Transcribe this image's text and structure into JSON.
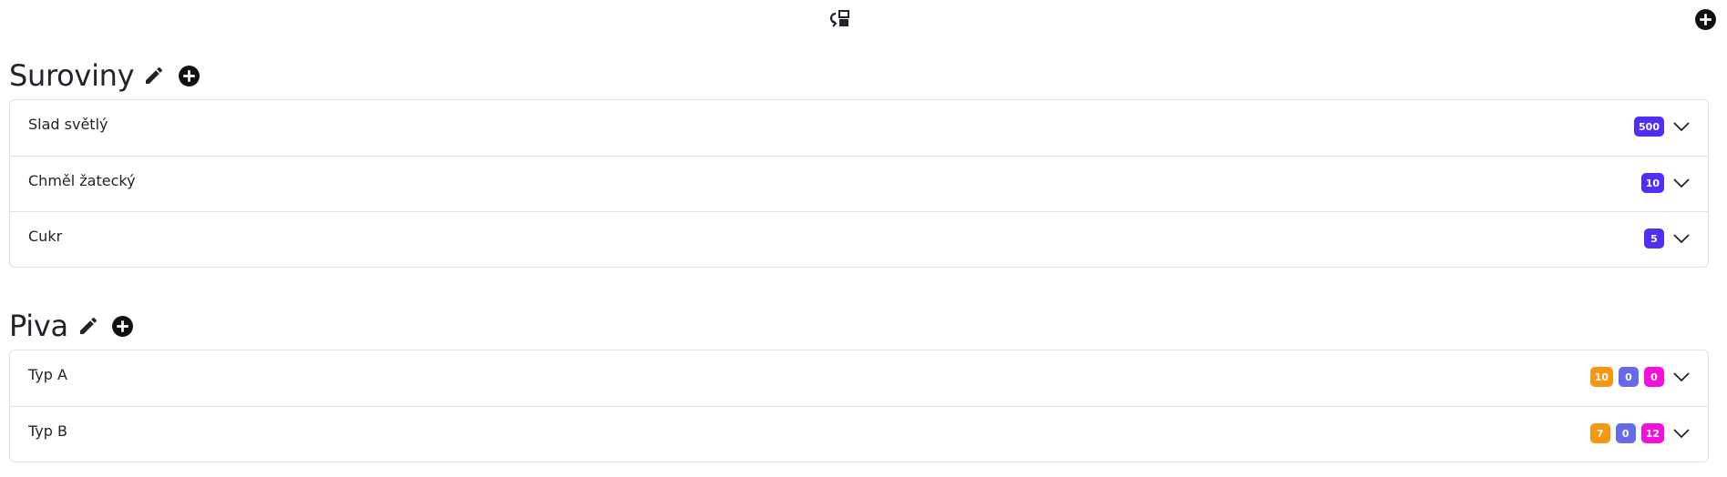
{
  "topbar": {
    "center_icon": "layout-toggle-icon",
    "right_icon": "plus-circle-icon"
  },
  "colors": {
    "primary_badge": "#4d2ff5",
    "orange_badge": "#f7960f",
    "blue_badge": "#6669e9",
    "magenta_badge": "#f50fdc",
    "border": "#dee2e6",
    "text": "#212529"
  },
  "sections": [
    {
      "title": "Suroviny",
      "items": [
        {
          "label": "Slad světlý",
          "badges": [
            "500"
          ]
        },
        {
          "label": "Chměl žatecký",
          "badges": [
            "10"
          ]
        },
        {
          "label": "Cukr",
          "badges": [
            "5"
          ]
        }
      ]
    },
    {
      "title": "Piva",
      "items": [
        {
          "label": "Typ A",
          "badges": [
            "10",
            "0",
            "0"
          ]
        },
        {
          "label": "Typ B",
          "badges": [
            "7",
            "0",
            "12"
          ]
        }
      ]
    }
  ]
}
